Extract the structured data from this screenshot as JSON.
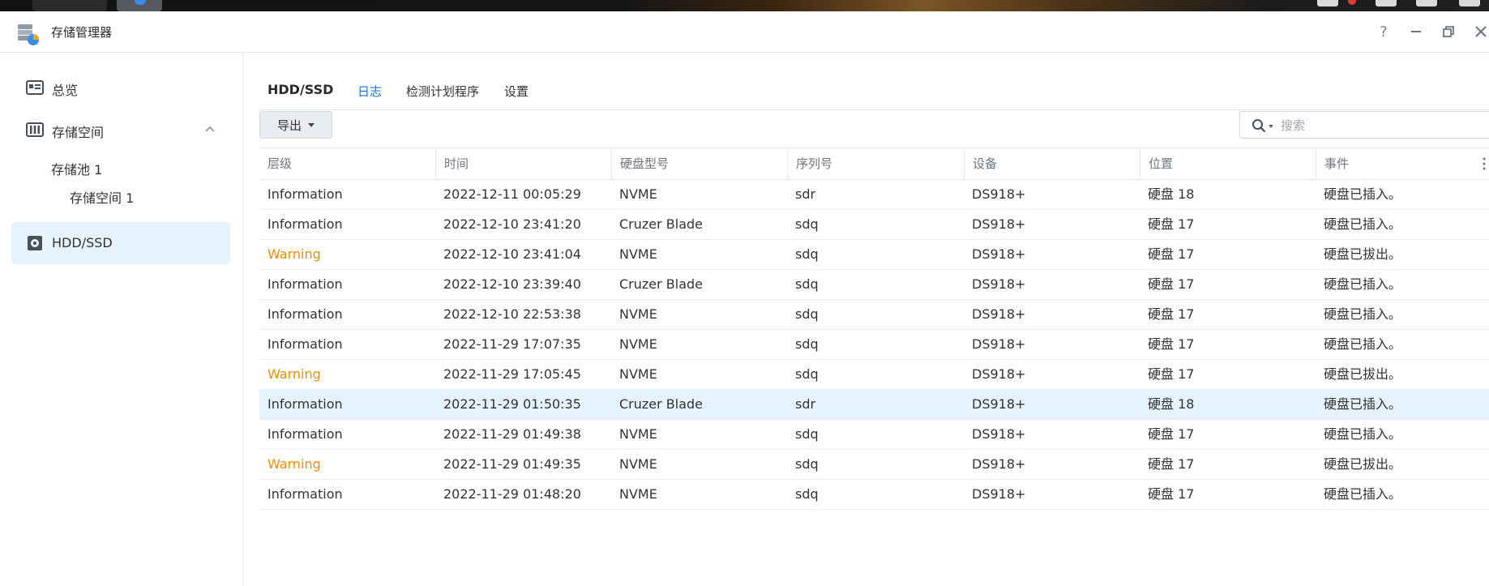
{
  "app": {
    "title": "存储管理器",
    "window_controls": [
      "help-icon",
      "minimize-icon",
      "restore-icon",
      "close-icon"
    ]
  },
  "sidebar": {
    "items": [
      {
        "label": "总览",
        "icon": "dashboard-icon"
      },
      {
        "label": "存储空间",
        "icon": "storage-icon",
        "expanded": true
      },
      {
        "label": "HDD/SSD",
        "icon": "disk-icon",
        "active": true
      }
    ],
    "subitems": [
      {
        "label": "存储池 1"
      },
      {
        "label": "存储空间 1"
      }
    ]
  },
  "tabs": [
    {
      "label": "HDD/SSD"
    },
    {
      "label": "日志",
      "active": true
    },
    {
      "label": "检测计划程序"
    },
    {
      "label": "设置"
    }
  ],
  "toolbar": {
    "export_label": "导出",
    "search_placeholder": "搜索"
  },
  "table": {
    "columns": [
      "层级",
      "时间",
      "硬盘型号",
      "序列号",
      "设备",
      "位置",
      "事件"
    ],
    "rows": [
      {
        "level": "Information",
        "time": "2022-12-11 00:05:29",
        "model": "NVME",
        "serial": "sdr",
        "device": "DS918+",
        "location": "硬盘 18",
        "event": "硬盘已插入。"
      },
      {
        "level": "Information",
        "time": "2022-12-10 23:41:20",
        "model": "Cruzer Blade",
        "serial": "sdq",
        "device": "DS918+",
        "location": "硬盘 17",
        "event": "硬盘已插入。"
      },
      {
        "level": "Warning",
        "time": "2022-12-10 23:41:04",
        "model": "NVME",
        "serial": "sdq",
        "device": "DS918+",
        "location": "硬盘 17",
        "event": "硬盘已拔出。"
      },
      {
        "level": "Information",
        "time": "2022-12-10 23:39:40",
        "model": "Cruzer Blade",
        "serial": "sdq",
        "device": "DS918+",
        "location": "硬盘 17",
        "event": "硬盘已插入。"
      },
      {
        "level": "Information",
        "time": "2022-12-10 22:53:38",
        "model": "NVME",
        "serial": "sdq",
        "device": "DS918+",
        "location": "硬盘 17",
        "event": "硬盘已插入。"
      },
      {
        "level": "Information",
        "time": "2022-11-29 17:07:35",
        "model": "NVME",
        "serial": "sdq",
        "device": "DS918+",
        "location": "硬盘 17",
        "event": "硬盘已插入。"
      },
      {
        "level": "Warning",
        "time": "2022-11-29 17:05:45",
        "model": "NVME",
        "serial": "sdq",
        "device": "DS918+",
        "location": "硬盘 17",
        "event": "硬盘已拔出。"
      },
      {
        "level": "Information",
        "time": "2022-11-29 01:50:35",
        "model": "Cruzer Blade",
        "serial": "sdr",
        "device": "DS918+",
        "location": "硬盘 18",
        "event": "硬盘已插入。",
        "selected": true
      },
      {
        "level": "Information",
        "time": "2022-11-29 01:49:38",
        "model": "NVME",
        "serial": "sdq",
        "device": "DS918+",
        "location": "硬盘 17",
        "event": "硬盘已插入。"
      },
      {
        "level": "Warning",
        "time": "2022-11-29 01:49:35",
        "model": "NVME",
        "serial": "sdq",
        "device": "DS918+",
        "location": "硬盘 17",
        "event": "硬盘已拔出。"
      },
      {
        "level": "Information",
        "time": "2022-11-29 01:48:20",
        "model": "NVME",
        "serial": "sdq",
        "device": "DS918+",
        "location": "硬盘 17",
        "event": "硬盘已插入。"
      }
    ]
  },
  "colors": {
    "accent": "#1a72d9",
    "warning": "#f08d0a",
    "selected_row": "#e6f2fc"
  }
}
